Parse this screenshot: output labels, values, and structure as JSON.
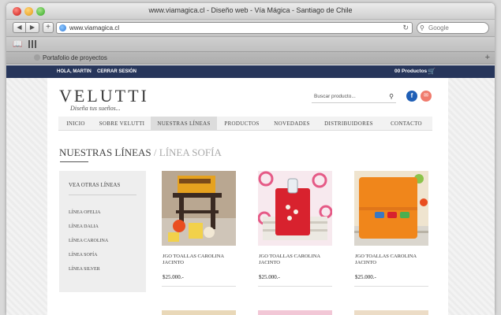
{
  "browser": {
    "window_title": "www.viamagica.cl - Diseño web - Vía Mágica - Santiago de Chile",
    "url": "www.viamagica.cl",
    "search_placeholder": "Google",
    "tab_title": "Portafolio de proyectos"
  },
  "topbar": {
    "greeting": "HOLA, MARTIN",
    "logout": "CERRAR SESIÓN",
    "cart": "00 Productos"
  },
  "header": {
    "logo": "VELUTTI",
    "tagline": "Diseña tus sueños...",
    "search_placeholder": "Buscar producto...",
    "facebook": "f",
    "mail": "✉"
  },
  "nav": {
    "items": [
      "INICIO",
      "SOBRE VELUTTI",
      "NUESTRAS LÍNEAS",
      "PRODUCTOS",
      "NOVEDADES",
      "DISTRIBUIDORES",
      "CONTACTO"
    ],
    "active": "NUESTRAS LÍNEAS"
  },
  "page": {
    "title": "NUESTRAS LÍNEAS",
    "subtitle": "/ LÍNEA SOFÍA"
  },
  "sidebar": {
    "title": "VEA OTRAS LÍNEAS",
    "items": [
      "LÍNEA OFELIA",
      "LÍNEA DALIA",
      "LÍNEA CAROLINA",
      "LÍNEA SOFÍA",
      "LÍNEA SILVER"
    ]
  },
  "products": [
    {
      "name": "JGO TOALLAS CAROLINA JACINTO",
      "price": "$25.000.-",
      "color": "#e6a21f"
    },
    {
      "name": "JGO TOALLAS CAROLINA JACINTO",
      "price": "$25.000.-",
      "color": "#d8222e"
    },
    {
      "name": "JGO TOALLAS CAROLINA JACINTO",
      "price": "$25.000.-",
      "color": "#f0861b"
    }
  ],
  "colors": {
    "topbar": "#27365b",
    "facebook": "#1f5fb6",
    "mail": "#f07b6d"
  }
}
